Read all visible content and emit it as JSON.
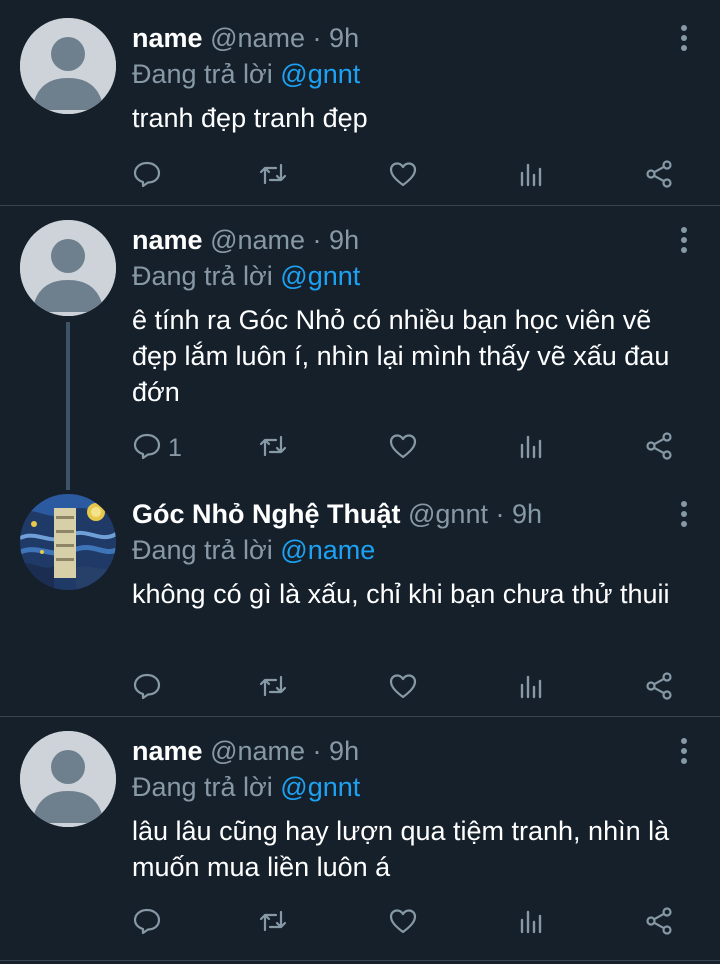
{
  "colors": {
    "background": "#15202b",
    "text": "#ffffff",
    "muted": "#8899a6",
    "link": "#1da1f2",
    "divider": "#38444d"
  },
  "tweets": [
    {
      "name": "name",
      "handle": "@name",
      "separator": "·",
      "time": "9h",
      "reply_prefix": "Đang trả lời",
      "reply_to": "@gnnt",
      "text": "tranh đẹp tranh đẹp",
      "reply_count": ""
    },
    {
      "name": "name",
      "handle": "@name",
      "separator": "·",
      "time": "9h",
      "reply_prefix": "Đang trả lời",
      "reply_to": "@gnnt",
      "text": "ê tính ra Góc Nhỏ có nhiều bạn học viên vẽ đẹp lắm luôn í, nhìn lại mình thấy vẽ xấu đau đớn",
      "reply_count": "1"
    },
    {
      "name": "Góc Nhỏ Nghệ Thuật",
      "handle": "@gnnt",
      "separator": "·",
      "time": "9h",
      "reply_prefix": "Đang trả lời",
      "reply_to": "@name",
      "text": "không có gì là xấu, chỉ khi bạn chưa thử thuii",
      "reply_count": ""
    },
    {
      "name": "name",
      "handle": "@name",
      "separator": "·",
      "time": "9h",
      "reply_prefix": "Đang trả lời",
      "reply_to": "@gnnt",
      "text": "lâu lâu cũng hay lượn qua tiệm tranh, nhìn là muốn mua liền luôn á",
      "reply_count": ""
    }
  ],
  "icons": {
    "reply": "reply-icon",
    "retweet": "retweet-icon",
    "like": "heart-icon",
    "analytics": "analytics-icon",
    "share": "share-icon",
    "more": "more-vertical-icon"
  }
}
